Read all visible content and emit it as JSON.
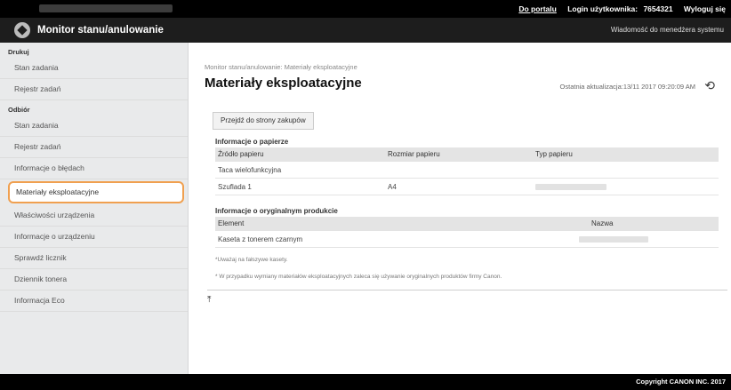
{
  "topbar": {
    "portal_link": "Do portalu",
    "login_label": "Login użytkownika:",
    "login_id": "7654321",
    "logout_link": "Wyloguj się"
  },
  "header": {
    "app_title": "Monitor stanu/anulowanie",
    "admin_message_link": "Wiadomość do menedżera systemu"
  },
  "sidebar": {
    "section_print": "Drukuj",
    "print_items": [
      "Stan zadania",
      "Rejestr zadań"
    ],
    "section_receive": "Odbiór",
    "receive_items": [
      "Stan zadania",
      "Rejestr zadań"
    ],
    "items": [
      "Informacje o błędach",
      "Materiały eksploatacyjne",
      "Właściwości urządzenia",
      "Informacje o urządzeniu",
      "Sprawdź licznik",
      "Dziennik tonera",
      "Informacja Eco"
    ],
    "active_item": "Materiały eksploatacyjne"
  },
  "main": {
    "breadcrumb": "Monitor stanu/anulowanie: Materiały eksploatacyjne",
    "page_title": "Materiały eksploatacyjne",
    "last_update": "Ostatnia aktualizacja:13/11 2017 09:20:09 AM",
    "purchase_button": "Przejdź do strony zakupów",
    "paper_section_title": "Informacje o papierze",
    "paper_headers": [
      "Źródło papieru",
      "Rozmiar papieru",
      "Typ papieru"
    ],
    "paper_rows": [
      {
        "source": "Taca wielofunkcyjna",
        "size": "",
        "type": ""
      },
      {
        "source": "Szuflada 1",
        "size": "A4",
        "type": ""
      }
    ],
    "genuine_section_title": "Informacje o oryginalnym produkcie",
    "genuine_headers": [
      "Element",
      "Nazwa"
    ],
    "genuine_rows": [
      {
        "element": "Kaseta z tonerem czarnym",
        "name": ""
      }
    ],
    "note_1": "*Uważaj na fałszywe kasety.",
    "note_2": "* W przypadku wymiany materiałów eksploatacyjnych zaleca się używanie oryginalnych produktów firmy Canon."
  },
  "footer": {
    "copyright": "Copyright CANON INC. 2017"
  },
  "colors": {
    "topbar": "#000000",
    "header": "#1d1d1d",
    "sidebar": "#e9eaeb",
    "active_outline": "#f0a050",
    "table_header": "#e4e4e4"
  }
}
